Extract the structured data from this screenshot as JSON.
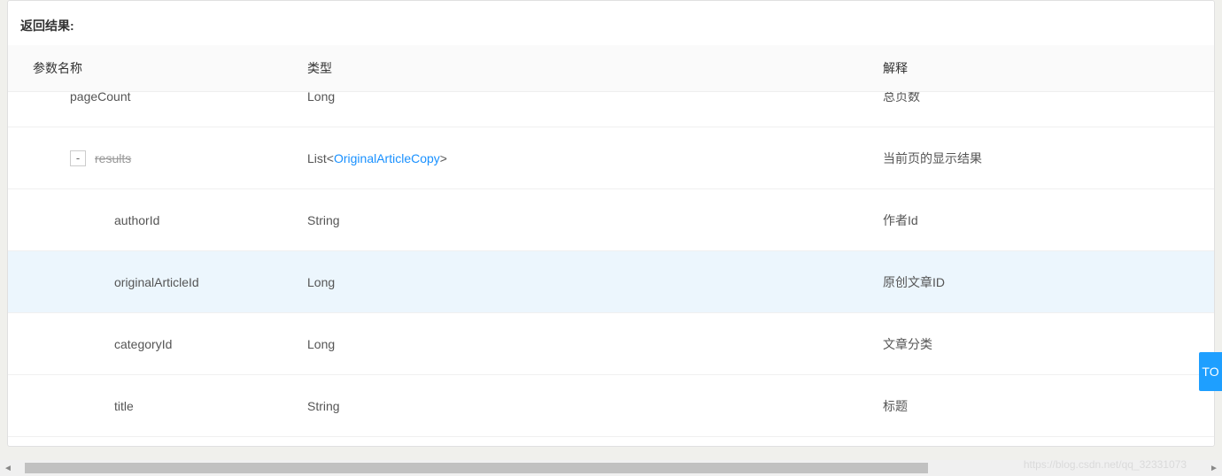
{
  "section_title": "返回结果:",
  "columns": {
    "name": "参数名称",
    "type": "类型",
    "desc": "解释"
  },
  "rows": [
    {
      "name": "pageCount",
      "type_prefix": "",
      "type_link": "",
      "type_suffix": "Long",
      "desc": "总页数",
      "indent": 1,
      "expand": false,
      "strike": false,
      "highlight": false
    },
    {
      "name": "results",
      "type_prefix": "List<",
      "type_link": "OriginalArticleCopy",
      "type_suffix": ">",
      "desc": "当前页的显示结果",
      "indent": 1,
      "expand": true,
      "strike": true,
      "highlight": false,
      "expand_label": "-"
    },
    {
      "name": "authorId",
      "type_prefix": "",
      "type_link": "",
      "type_suffix": "String",
      "desc": "作者Id",
      "indent": 2,
      "expand": false,
      "strike": false,
      "highlight": false
    },
    {
      "name": "originalArticleId",
      "type_prefix": "",
      "type_link": "",
      "type_suffix": "Long",
      "desc": "原创文章ID",
      "indent": 2,
      "expand": false,
      "strike": false,
      "highlight": true
    },
    {
      "name": "categoryId",
      "type_prefix": "",
      "type_link": "",
      "type_suffix": "Long",
      "desc": "文章分类",
      "indent": 2,
      "expand": false,
      "strike": false,
      "highlight": false
    },
    {
      "name": "title",
      "type_prefix": "",
      "type_link": "",
      "type_suffix": "String",
      "desc": "标题",
      "indent": 2,
      "expand": false,
      "strike": false,
      "highlight": false
    }
  ],
  "side_tab_label": "TO",
  "watermark": "https://blog.csdn.net/qq_32331073"
}
